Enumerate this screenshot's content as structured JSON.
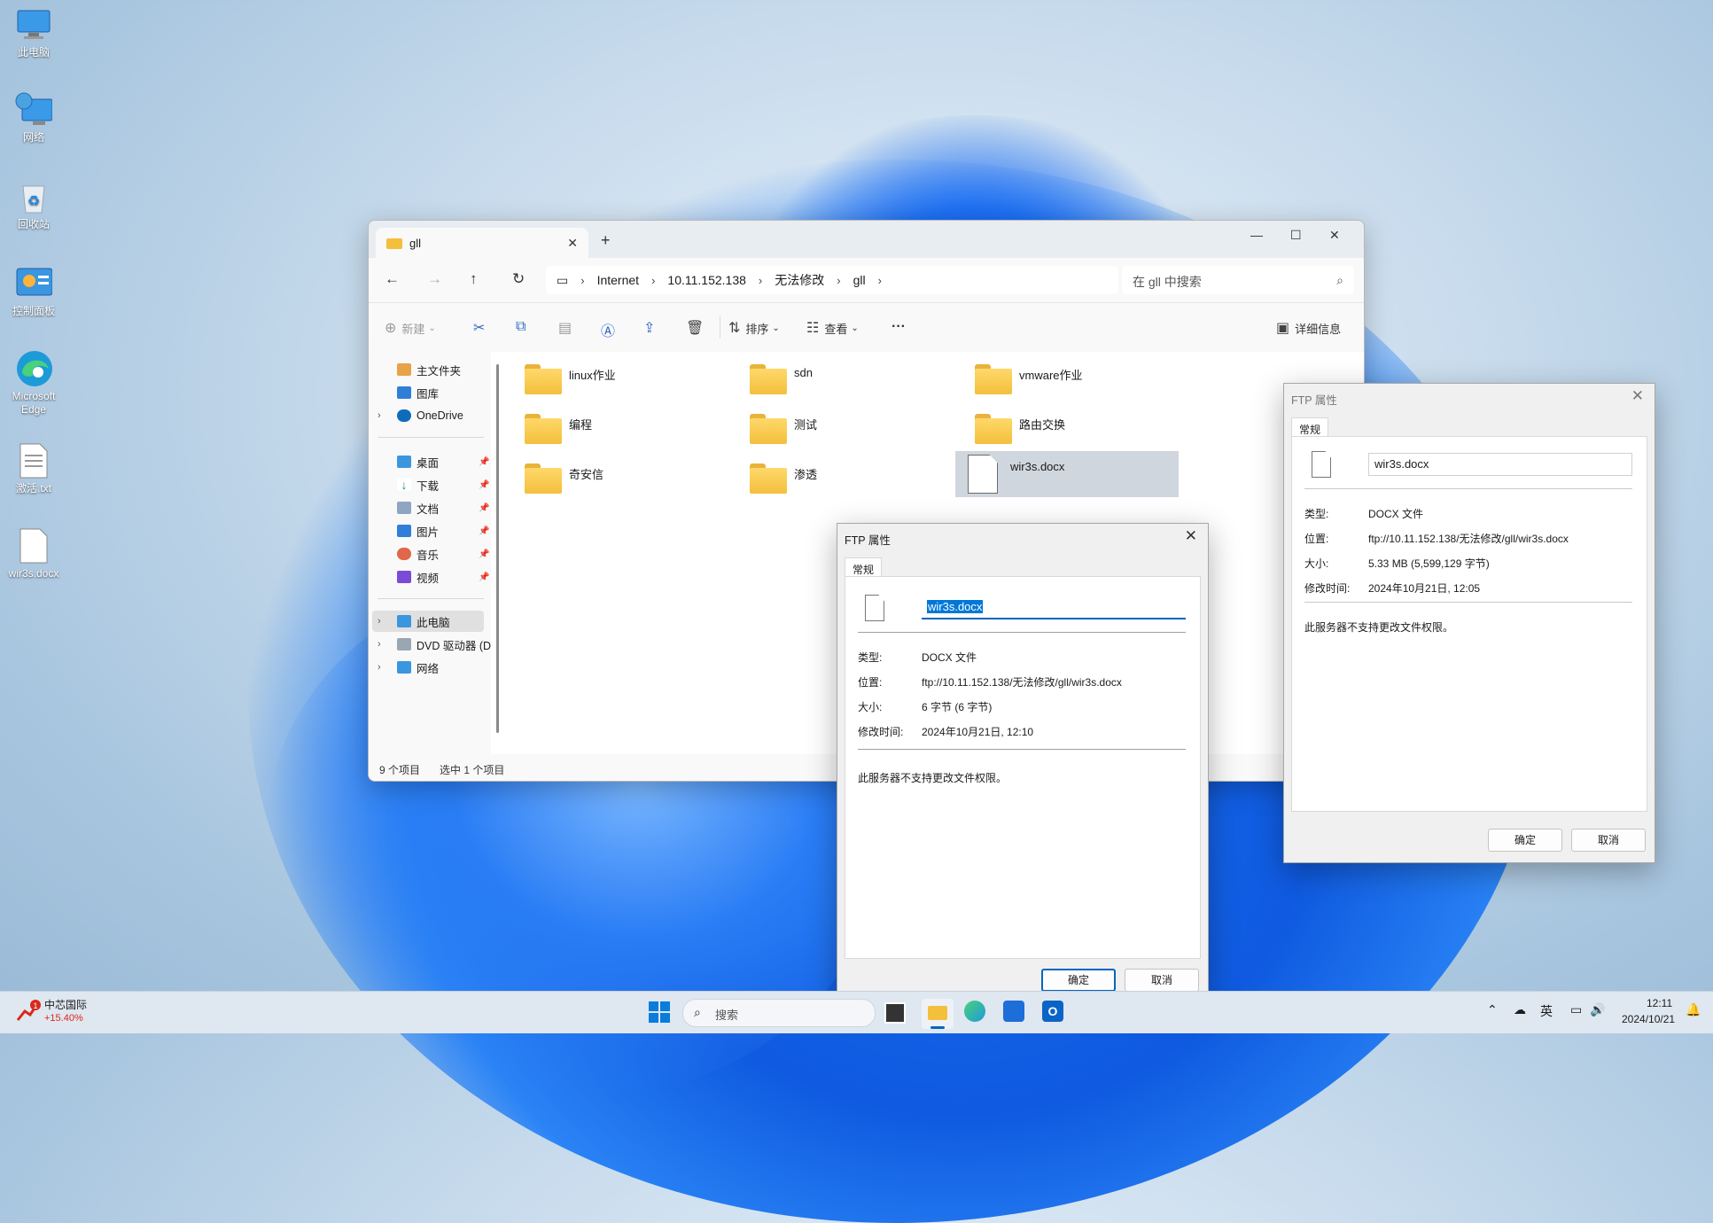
{
  "desktop": {
    "icons": [
      "此电脑",
      "网络",
      "回收站",
      "控制面板",
      "Microsoft Edge",
      "激活.txt",
      "wir3s.docx"
    ]
  },
  "explorer": {
    "tab_title": "gll",
    "breadcrumb": [
      "Internet",
      "10.11.152.138",
      "无法修改",
      "gll"
    ],
    "search_placeholder": "在 gll 中搜索",
    "toolbar": {
      "new": "新建",
      "sort": "排序",
      "view": "查看",
      "more": "···",
      "details": "详细信息"
    },
    "sidebar": {
      "home": "主文件夹",
      "gallery": "图库",
      "onedrive": "OneDrive",
      "desktop": "桌面",
      "downloads": "下载",
      "documents": "文档",
      "pictures": "图片",
      "music": "音乐",
      "videos": "视频",
      "thispc": "此电脑",
      "dvd": "DVD 驱动器 (D",
      "network": "网络"
    },
    "items": [
      "linux作业",
      "sdn",
      "vmware作业",
      "编程",
      "测试",
      "路由交换",
      "奇安信",
      "渗透",
      "wir3s.docx"
    ],
    "status_count": "9 个项目",
    "status_selected": "选中 1 个项目"
  },
  "dialog_front": {
    "title": "FTP 属性",
    "tab": "常规",
    "name": "wir3s.docx",
    "type_label": "类型:",
    "type_value": "DOCX 文件",
    "location_label": "位置:",
    "location_value": "ftp://10.11.152.138/无法修改/gll/wir3s.docx",
    "size_label": "大小:",
    "size_value": "6 字节 (6 字节)",
    "modified_label": "修改时间:",
    "modified_value": "2024年10月21日, 12:10",
    "note": "此服务器不支持更改文件权限。",
    "ok": "确定",
    "cancel": "取消"
  },
  "dialog_back": {
    "title": "FTP 属性",
    "tab": "常规",
    "name": "wir3s.docx",
    "type_label": "类型:",
    "type_value": "DOCX 文件",
    "location_label": "位置:",
    "location_value": "ftp://10.11.152.138/无法修改/gll/wir3s.docx",
    "size_label": "大小:",
    "size_value": "5.33 MB (5,599,129 字节)",
    "modified_label": "修改时间:",
    "modified_value": "2024年10月21日, 12:05",
    "note": "此服务器不支持更改文件权限。",
    "ok": "确定",
    "cancel": "取消"
  },
  "taskbar": {
    "stock_name": "中芯国际",
    "stock_change": "+15.40%",
    "stock_badge": "1",
    "search_placeholder": "搜索",
    "ime": "英",
    "time": "12:11",
    "date": "2024/10/21"
  },
  "colors": {
    "accent": "#0067c0",
    "stock_up": "#d9281c",
    "folder": "#f3bf3d"
  }
}
